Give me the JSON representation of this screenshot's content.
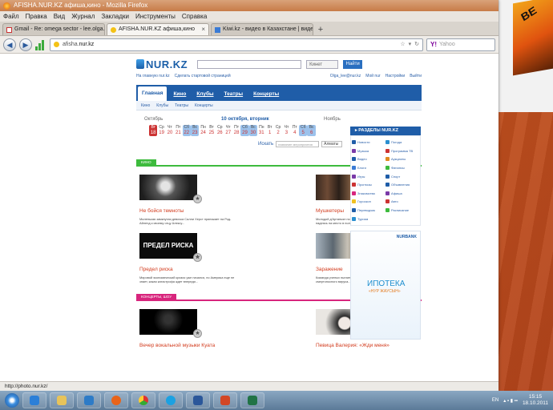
{
  "colors": {
    "accent_blue": "#1f5da8",
    "green_section": "#3dbb3d",
    "pink_section": "#d8257d",
    "title_red": "#d23b1d"
  },
  "window": {
    "title": "AFISHA.NUR.KZ афиша,кино - Mozilla Firefox"
  },
  "menu": [
    "Файл",
    "Правка",
    "Вид",
    "Журнал",
    "Закладки",
    "Инструменты",
    "Справка"
  ],
  "tabs": [
    {
      "label": "Gmail - Re: omega sector - lee.olga.g...",
      "icon": "gmail-icon"
    },
    {
      "label": "AFISHA.NUR.KZ афиша,кино",
      "icon": "nur-icon"
    },
    {
      "label": "Kiwi.kz - видео в Казахстане | видео-...",
      "icon": "kiwi-icon"
    }
  ],
  "address": {
    "prefix": "afisha.",
    "domain": "nur.kz"
  },
  "search_placeholder": "Yahoo",
  "site": {
    "logo": "NUR.KZ",
    "search_select": "Кинет",
    "search_button": "Найти",
    "util_left": [
      "На главную nur.kz",
      "Сделать стартовой страницей"
    ],
    "util_right": [
      "Olga_lee@nur.kz",
      "Мой nur",
      "Настройки",
      "Выйти"
    ],
    "mainnav": [
      "Главная",
      "Кино",
      "Клубы",
      "Театры",
      "Концерты"
    ],
    "subnav": [
      "Кино",
      "Клубы",
      "Театры",
      "Концерты"
    ],
    "calendar": {
      "month_left": "Октябрь",
      "month_right": "Ноябрь",
      "today_label": "10 октября, вторник",
      "days": [
        {
          "w": "Вт",
          "n": "18"
        },
        {
          "w": "Ср",
          "n": "19"
        },
        {
          "w": "Чт",
          "n": "20"
        },
        {
          "w": "Пт",
          "n": "21"
        },
        {
          "w": "Сб",
          "n": "22"
        },
        {
          "w": "Вс",
          "n": "23"
        },
        {
          "w": "Пн",
          "n": "24"
        },
        {
          "w": "Вт",
          "n": "25"
        },
        {
          "w": "Ср",
          "n": "26"
        },
        {
          "w": "Чт",
          "n": "27"
        },
        {
          "w": "Пт",
          "n": "28"
        },
        {
          "w": "Сб",
          "n": "29"
        },
        {
          "w": "Вс",
          "n": "30"
        },
        {
          "w": "Пн",
          "n": "31"
        },
        {
          "w": "Вт",
          "n": "1"
        },
        {
          "w": "Ср",
          "n": "2"
        },
        {
          "w": "Чт",
          "n": "3"
        },
        {
          "w": "Пт",
          "n": "4"
        },
        {
          "w": "Сб",
          "n": "5"
        },
        {
          "w": "Вс",
          "n": "6"
        }
      ],
      "search_label": "Искать",
      "search_placeholder": "название мероприятия",
      "city": "Алматы"
    },
    "section_kino": "КИНО",
    "section_concerts": "КОНЦЕРТЫ, ШОУ",
    "cards": [
      {
        "title": "Не бойся темноты",
        "desc": "Маленькая замкнутая девочка Салли Херст приезжает на Род-Айленд к своему отцу Алексу..."
      },
      {
        "title": "Мушкетеры",
        "desc": "Молодой д'Артаньян покинул родной дом и отправился в Париж, надеясь на место в полку мушкетеров...."
      },
      {
        "title": "Предел риска",
        "desc": "Мировой экономический кризис уже начался, но Америка еще не знает, какая катастрофа ждет впереди...",
        "thumb_text": "ПРЕДЕЛ РИСКА"
      },
      {
        "title": "Заражение",
        "desc": "Команда ученых пытается остановить распространение смертоносного вируса..."
      },
      {
        "title": "Вечер вокальной музыки Куата",
        "desc": ""
      },
      {
        "title": "Певица Валерия: «Жди меня»",
        "desc": ""
      }
    ],
    "sections_header": "РАЗДЕЛЫ NUR.KZ",
    "sections": [
      {
        "label": "Новости",
        "color": "#1f5da8"
      },
      {
        "label": "Погода",
        "color": "#2a8fd0"
      },
      {
        "label": "Музыка",
        "color": "#7a3aa8"
      },
      {
        "label": "Программа ТВ",
        "color": "#c33"
      },
      {
        "label": "Видео",
        "color": "#1f5da8"
      },
      {
        "label": "Аукционы",
        "color": "#e08a1f"
      },
      {
        "label": "Блоги",
        "color": "#3a7bd5"
      },
      {
        "label": "Финансы",
        "color": "#3dbb3d"
      },
      {
        "label": "Игры",
        "color": "#7a3aa8"
      },
      {
        "label": "Спорт",
        "color": "#1f5da8"
      },
      {
        "label": "Прогнозы",
        "color": "#c33"
      },
      {
        "label": "Объявления",
        "color": "#1f5da8"
      },
      {
        "label": "Знакомства",
        "color": "#d8257d"
      },
      {
        "label": "Афиша",
        "color": "#7a3aa8"
      },
      {
        "label": "Гороскоп",
        "color": "#f0c020"
      },
      {
        "label": "Авто",
        "color": "#c33"
      },
      {
        "label": "Переводчик",
        "color": "#1f5da8"
      },
      {
        "label": "Расписание",
        "color": "#3dbb3d"
      },
      {
        "label": "Туризм",
        "color": "#2a8fd0"
      }
    ],
    "banner": {
      "bank": "NURBANK",
      "title": "ИПОТЕКА",
      "subtitle": "«НУР ЖАУСЫН»"
    }
  },
  "status_url": "http://photo.nur.kz/",
  "taskbar": {
    "lang": "EN",
    "time": "15:15",
    "date": "18.10.2011"
  },
  "book_text": "BE"
}
